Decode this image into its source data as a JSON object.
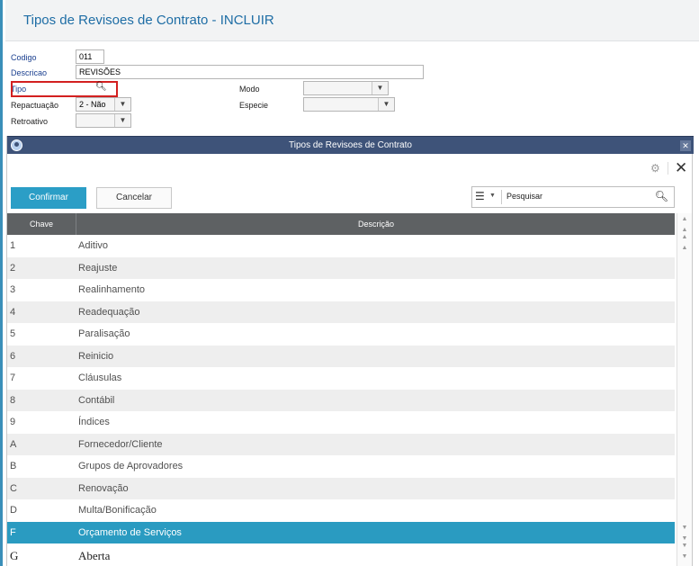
{
  "page": {
    "title": "Tipos de Revisoes de Contrato - INCLUIR"
  },
  "form": {
    "codigo": {
      "label": "Codigo",
      "value": "011"
    },
    "descricao": {
      "label": "Descricao",
      "value": "REVISÕES"
    },
    "tipo": {
      "label": "Tipo",
      "value": ""
    },
    "modo": {
      "label": "Modo",
      "value": ""
    },
    "repactuacao": {
      "label": "Repactuação",
      "value": "2 - Não"
    },
    "especie": {
      "label": "Especie",
      "value": ""
    },
    "retroativo": {
      "label": "Retroativo",
      "value": ""
    }
  },
  "dialog": {
    "title": "Tipos de Revisoes de Contrato",
    "confirm_label": "Confirmar",
    "cancel_label": "Cancelar",
    "search_placeholder": "Pesquisar",
    "columns": [
      "Chave",
      "Descrição"
    ],
    "rows": [
      {
        "key": "1",
        "desc": "Aditivo"
      },
      {
        "key": "2",
        "desc": "Reajuste"
      },
      {
        "key": "3",
        "desc": "Realinhamento"
      },
      {
        "key": "4",
        "desc": "Readequação"
      },
      {
        "key": "5",
        "desc": "Paralisação"
      },
      {
        "key": "6",
        "desc": "Reinicio"
      },
      {
        "key": "7",
        "desc": "Cláusulas"
      },
      {
        "key": "8",
        "desc": "Contábil"
      },
      {
        "key": "9",
        "desc": "Índices"
      },
      {
        "key": "A",
        "desc": "Fornecedor/Cliente"
      },
      {
        "key": "B",
        "desc": "Grupos de Aprovadores"
      },
      {
        "key": "C",
        "desc": "Renovação"
      },
      {
        "key": "D",
        "desc": "Multa/Bonificação"
      },
      {
        "key": "F",
        "desc": "Orçamento de Serviços"
      },
      {
        "key": "G",
        "desc": "Aberta"
      }
    ],
    "selected_key": "F"
  },
  "colors": {
    "accent": "#2a9bc1",
    "header_bar": "#3e5379",
    "grid_header": "#5e6163",
    "title_text": "#1e6da5",
    "highlight_border": "#d32020"
  },
  "icons": {
    "search": "search-icon",
    "gear": "gear-icon",
    "close": "close-icon",
    "filter": "column-filter-icon"
  }
}
